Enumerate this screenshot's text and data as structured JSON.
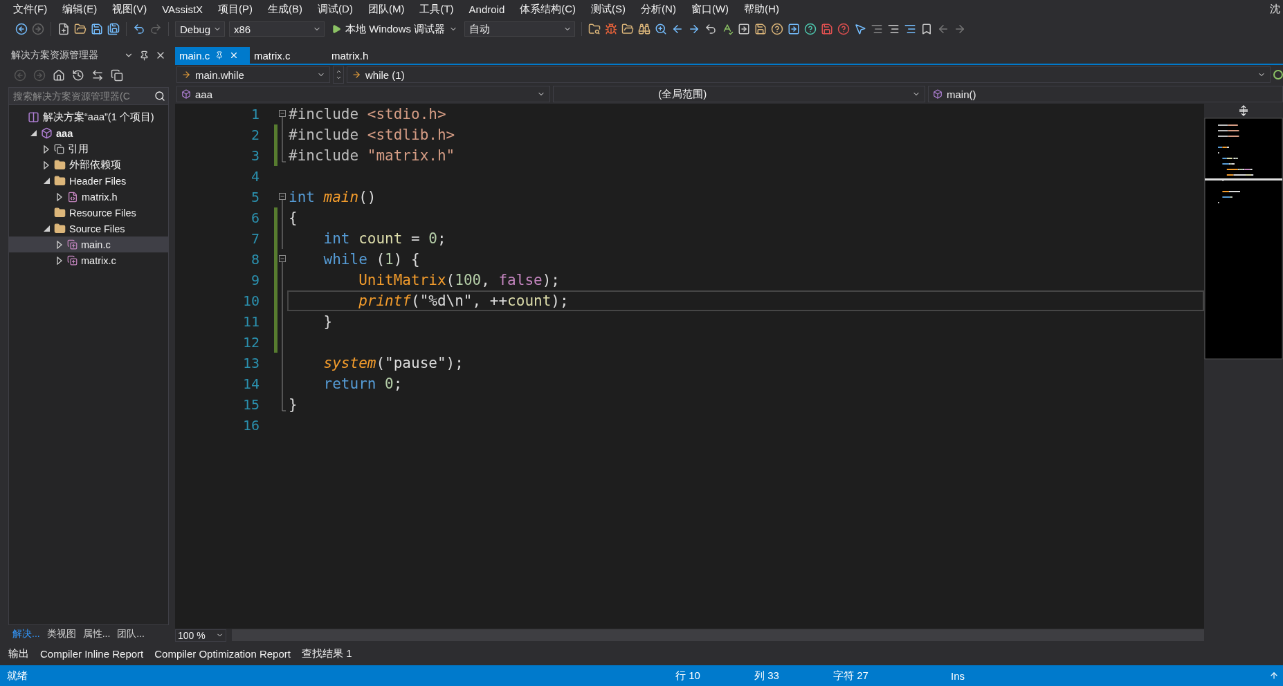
{
  "menu": [
    "文件(F)",
    "编辑(E)",
    "视图(V)",
    "VAssistX",
    "项目(P)",
    "生成(B)",
    "调试(D)",
    "团队(M)",
    "工具(T)",
    "Android",
    "体系结构(C)",
    "测试(S)",
    "分析(N)",
    "窗口(W)",
    "帮助(H)"
  ],
  "user": "沈",
  "toolbar": {
    "configuration": "Debug",
    "platform": "x86",
    "debugger": "本地 Windows 调试器",
    "mode": "自动"
  },
  "solution_explorer": {
    "title": "解决方案资源管理器",
    "search": {
      "placeholder": "搜索解决方案资源管理器(C"
    },
    "tree": [
      {
        "label": "解决方案“aaa”(1 个项目)",
        "kind": "solution",
        "selected": false,
        "children": [
          {
            "label": "aaa",
            "kind": "project",
            "expanded": true,
            "selected": false,
            "children": [
              {
                "label": "引用",
                "kind": "reference",
                "expanded": false,
                "selected": false
              },
              {
                "label": "外部依赖项",
                "kind": "external",
                "expanded": false,
                "selected": false
              },
              {
                "label": "Header Files",
                "kind": "filter",
                "expanded": true,
                "selected": false,
                "children": [
                  {
                    "label": "matrix.h",
                    "kind": "header",
                    "expanded": false,
                    "selected": false
                  }
                ]
              },
              {
                "label": "Resource Files",
                "kind": "filter",
                "selected": false
              },
              {
                "label": "Source Files",
                "kind": "filter",
                "expanded": true,
                "selected": false,
                "children": [
                  {
                    "label": "main.c",
                    "kind": "source",
                    "expanded": false,
                    "selected": true
                  },
                  {
                    "label": "matrix.c",
                    "kind": "source",
                    "expanded": false,
                    "selected": false
                  }
                ]
              }
            ]
          }
        ]
      }
    ],
    "bottom_tabs": [
      {
        "label": "解决...",
        "selected": true
      },
      {
        "label": "类视图",
        "selected": false
      },
      {
        "label": "属性...",
        "selected": false
      },
      {
        "label": "团队...",
        "selected": false
      }
    ]
  },
  "editor": {
    "tabs": [
      {
        "label": "main.c",
        "selected": true
      },
      {
        "label": "matrix.c",
        "selected": false
      },
      {
        "label": "matrix.h",
        "selected": false
      }
    ],
    "navigation": {
      "context": "main.while",
      "statement": "while (1)",
      "project": "aaa",
      "scope": "(全局范围)",
      "member": "main()"
    },
    "lines": [
      {
        "number": "1",
        "kind": "fold-start",
        "changed": false,
        "current": false,
        "tokens": [
          {
            "kind": "preproc",
            "text": "#include "
          },
          {
            "kind": "header",
            "text": "<stdio.h>"
          }
        ]
      },
      {
        "number": "2",
        "kind": "fold-inside",
        "changed": true,
        "current": false,
        "tokens": [
          {
            "kind": "preproc",
            "text": "#include "
          },
          {
            "kind": "header",
            "text": "<stdlib.h>"
          }
        ]
      },
      {
        "number": "3",
        "kind": "fold-end",
        "changed": true,
        "current": false,
        "tokens": [
          {
            "kind": "preproc",
            "text": "#include "
          },
          {
            "kind": "header",
            "text": "\"matrix.h\""
          }
        ]
      },
      {
        "number": "4",
        "kind": "plain",
        "changed": false,
        "current": false
      },
      {
        "number": "5",
        "kind": "fold-start",
        "changed": false,
        "current": false,
        "tokens": [
          {
            "kind": "keyword",
            "text": "int "
          },
          {
            "kind": "func-italic",
            "text": "main"
          },
          {
            "kind": "plain",
            "text": "()"
          }
        ]
      },
      {
        "number": "6",
        "kind": "fold-inside",
        "changed": true,
        "current": false,
        "tokens": [
          {
            "kind": "plain",
            "text": "{"
          }
        ]
      },
      {
        "number": "7",
        "kind": "fold-inside",
        "changed": true,
        "current": false,
        "tokens": [
          {
            "kind": "keyword",
            "text": "    int "
          },
          {
            "kind": "variable",
            "text": "count"
          },
          {
            "kind": "plain",
            "text": " = "
          },
          {
            "kind": "number",
            "text": "0"
          },
          {
            "kind": "plain",
            "text": ";"
          }
        ]
      },
      {
        "number": "8",
        "kind": "fold-start",
        "changed": true,
        "current": false,
        "tokens": [
          {
            "kind": "keyword",
            "text": "    while "
          },
          {
            "kind": "plain",
            "text": "("
          },
          {
            "kind": "number",
            "text": "1"
          },
          {
            "kind": "plain",
            "text": ") {"
          }
        ]
      },
      {
        "number": "9",
        "kind": "fold-inside",
        "changed": true,
        "current": false,
        "tokens": [
          {
            "kind": "function",
            "text": "        UnitMatrix"
          },
          {
            "kind": "plain",
            "text": "("
          },
          {
            "kind": "number",
            "text": "100"
          },
          {
            "kind": "plain",
            "text": ", "
          },
          {
            "kind": "constant",
            "text": "false"
          },
          {
            "kind": "plain",
            "text": ");"
          }
        ]
      },
      {
        "number": "10",
        "kind": "fold-inside",
        "changed": true,
        "current": true,
        "tokens": [
          {
            "kind": "func-italic",
            "text": "        printf"
          },
          {
            "kind": "plain",
            "text": "(\"%d\\n\", ++"
          },
          {
            "kind": "variable",
            "text": "count"
          },
          {
            "kind": "plain",
            "text": ");"
          }
        ]
      },
      {
        "number": "11",
        "kind": "fold-inside",
        "changed": true,
        "current": false,
        "tokens": [
          {
            "kind": "plain",
            "text": "    }"
          }
        ]
      },
      {
        "number": "12",
        "kind": "fold-inside",
        "changed": true,
        "current": false
      },
      {
        "number": "13",
        "kind": "fold-inside",
        "changed": false,
        "current": false,
        "tokens": [
          {
            "kind": "func-italic",
            "text": "    system"
          },
          {
            "kind": "plain",
            "text": "(\"pause\");"
          }
        ]
      },
      {
        "number": "14",
        "kind": "fold-inside",
        "changed": false,
        "current": false,
        "tokens": [
          {
            "kind": "keyword",
            "text": "    return "
          },
          {
            "kind": "number",
            "text": "0"
          },
          {
            "kind": "plain",
            "text": ";"
          }
        ]
      },
      {
        "number": "15",
        "kind": "fold-end",
        "changed": false,
        "current": false,
        "tokens": [
          {
            "kind": "plain",
            "text": "}"
          }
        ]
      },
      {
        "number": "16",
        "kind": "plain",
        "changed": false,
        "current": false
      }
    ],
    "zoom": "100 %"
  },
  "output_tabs": [
    "输出",
    "Compiler Inline Report",
    "Compiler Optimization Report",
    "查找结果 1"
  ],
  "status_bar": {
    "message": "就绪",
    "line": "行 10",
    "column": "列 33",
    "character": "字符 27",
    "mode": "Ins"
  }
}
